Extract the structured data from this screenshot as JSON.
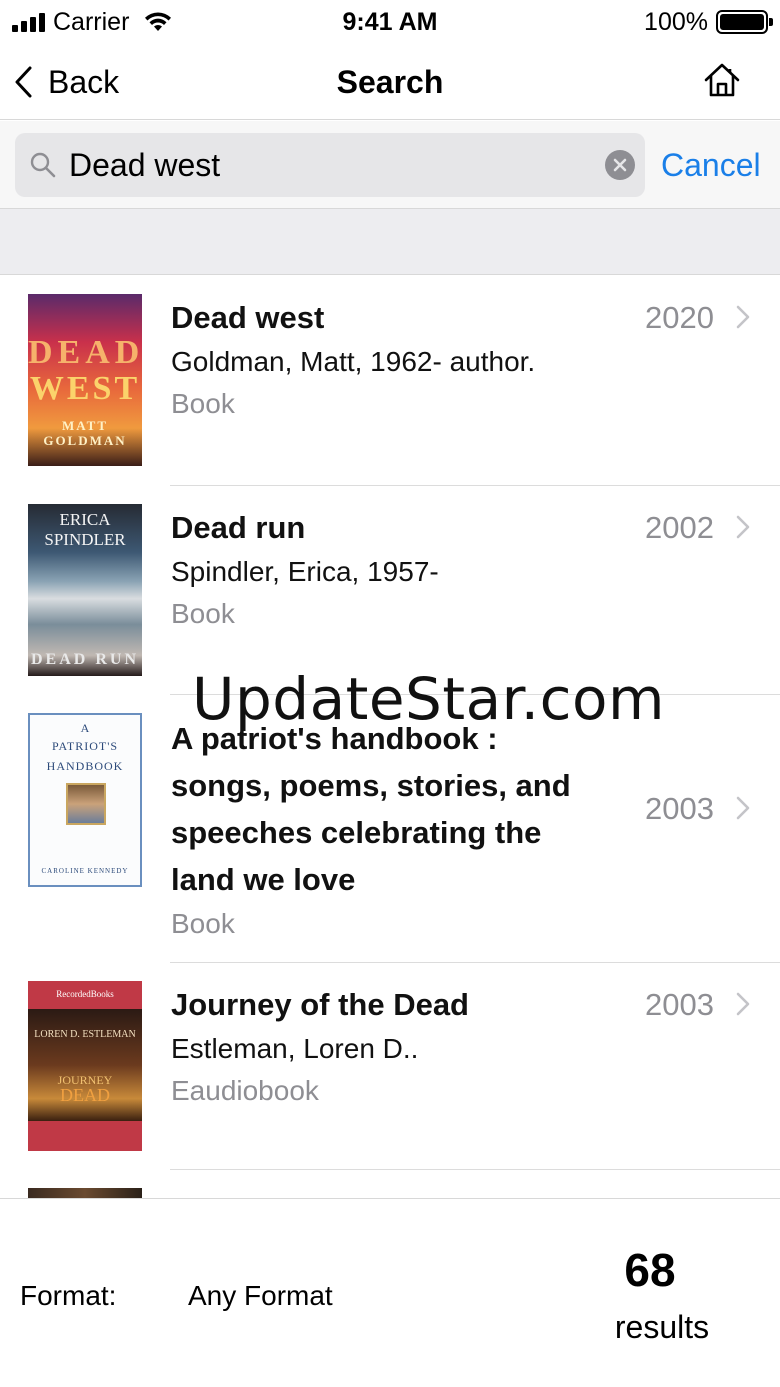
{
  "status_bar": {
    "carrier": "Carrier",
    "time": "9:41 AM",
    "battery": "100%"
  },
  "nav": {
    "back_label": "Back",
    "title": "Search",
    "home_icon": "home-icon"
  },
  "search": {
    "query": "Dead west",
    "cancel_label": "Cancel"
  },
  "results": [
    {
      "title": "Dead west",
      "author": "Goldman, Matt, 1962- author.",
      "format": "Book",
      "year": "2020",
      "cover": {
        "line1": "DEAD",
        "line2": "WEST",
        "line3": "MATT GOLDMAN"
      }
    },
    {
      "title": "Dead run",
      "author": "Spindler, Erica, 1957-",
      "format": "Book",
      "year": "2002",
      "cover": {
        "line1": "ERICA SPINDLER",
        "line2": "DEAD RUN"
      }
    },
    {
      "title": "A patriot's handbook : songs, poems, stories, and speeches celebrating the land we love",
      "author": "",
      "format": "Book",
      "year": "2003",
      "cover": {
        "line1": "A",
        "line2": "PATRIOT'S",
        "line3": "HANDBOOK",
        "line4": "CAROLINE KENNEDY"
      }
    },
    {
      "title": "Journey of the Dead",
      "author": "Estleman, Loren D..",
      "format": "Eaudiobook",
      "year": "2003",
      "cover": {
        "line1": "RecordedBooks",
        "line2": "LOREN D. ESTLEMAN",
        "line3": "JOURNEY",
        "line4": "DEAD"
      }
    }
  ],
  "watermark": "UpdateStar.com",
  "footer": {
    "format_label": "Format:",
    "format_value": "Any Format",
    "result_count": "68",
    "result_label": "results"
  },
  "colors": {
    "accent": "#1a7fe8",
    "secondary_text": "#8e8e93",
    "divider": "#dcdcdc"
  }
}
